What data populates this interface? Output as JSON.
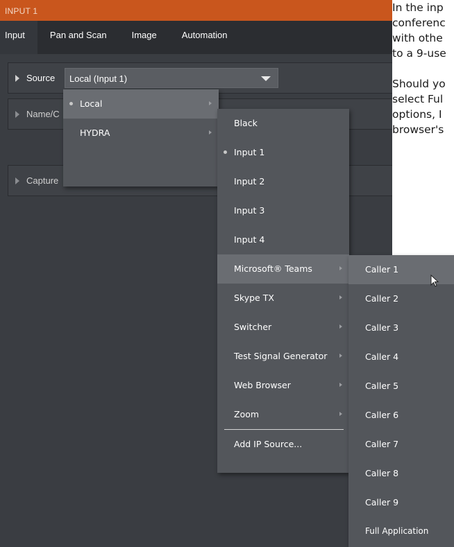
{
  "doc": {
    "lines": [
      "In the inp",
      "conferenc",
      "with othe",
      "to a 9-use",
      "",
      "Should yo",
      "select Ful",
      "options, I",
      "browser's"
    ]
  },
  "panel": {
    "title": "INPUT 1",
    "tabs": [
      "Input",
      "Pan and Scan",
      "Image",
      "Automation"
    ],
    "rows": {
      "source": "Source",
      "name": "Name/C",
      "capture": "Capture"
    },
    "source_value": "Local (Input 1)"
  },
  "menu1": {
    "items": [
      {
        "label": "Local",
        "selected": true
      },
      {
        "label": "HYDRA",
        "selected": false
      }
    ]
  },
  "menu2": {
    "items": [
      {
        "label": "Black"
      },
      {
        "label": "Input 1",
        "selected": true
      },
      {
        "label": "Input 2"
      },
      {
        "label": "Input 3"
      },
      {
        "label": "Input 4"
      },
      {
        "label": "Microsoft® Teams",
        "submenu": true
      },
      {
        "label": "Skype TX",
        "submenu": true
      },
      {
        "label": "Switcher",
        "submenu": true
      },
      {
        "label": "Test Signal Generator",
        "submenu": true
      },
      {
        "label": "Web Browser",
        "submenu": true
      },
      {
        "label": "Zoom",
        "submenu": true
      }
    ],
    "footer": "Add IP Source..."
  },
  "menu3": {
    "items": [
      "Caller 1",
      "Caller 2",
      "Caller 3",
      "Caller 4",
      "Caller 5",
      "Caller 6",
      "Caller 7",
      "Caller 8",
      "Caller 9",
      "Full Application"
    ]
  },
  "colors": {
    "titlebar": "#c9561d",
    "panel": "#3a3d42",
    "menu": "#53565b",
    "highlight": "#6a6d72"
  },
  "icons": [
    "expand-triangle-icon",
    "dropdown-caret-icon",
    "submenu-arrow-icon",
    "mouse-cursor-icon"
  ]
}
